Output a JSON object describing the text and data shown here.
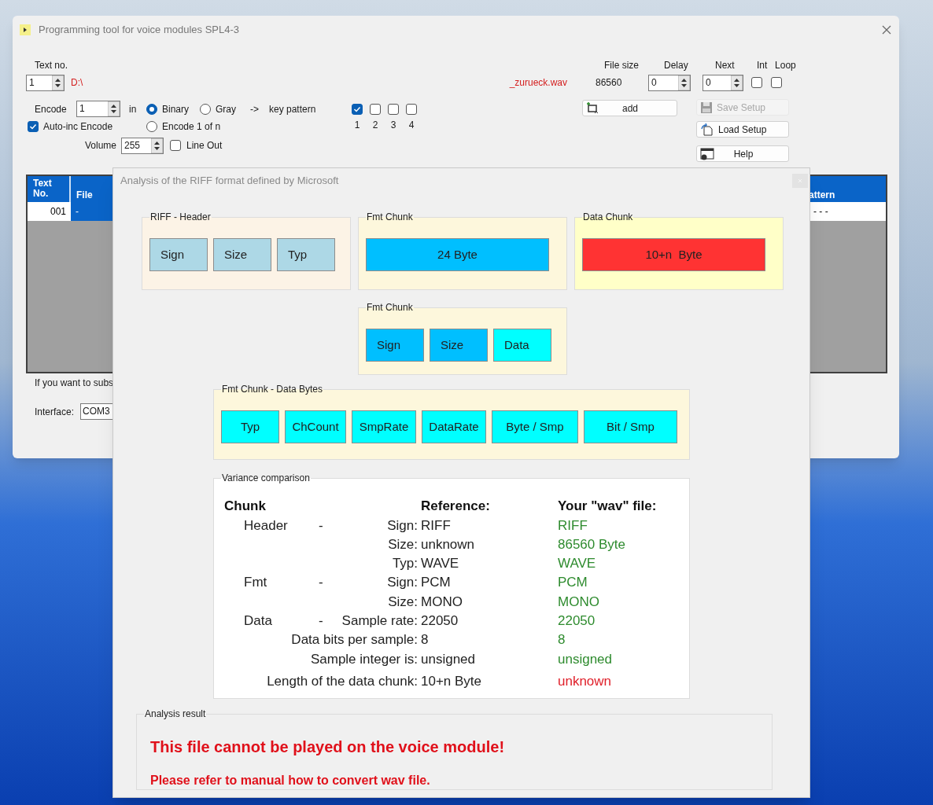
{
  "main_window": {
    "title": "Programming tool for voice modules SPL4-3",
    "text_no": {
      "label": "Text no.",
      "value": "1"
    },
    "path": "D:\\",
    "file_name": "_zurueck.wav",
    "file_size": {
      "label": "File size",
      "value": "86560"
    },
    "delay": {
      "label": "Delay",
      "value": "0"
    },
    "next": {
      "label": "Next",
      "value": "0"
    },
    "int": {
      "label": "Int",
      "checked": false
    },
    "loop": {
      "label": "Loop",
      "checked": false
    },
    "encode": {
      "label": "Encode",
      "value": "1",
      "in_label": "in"
    },
    "encode_modes": [
      {
        "label": "Binary",
        "selected": true
      },
      {
        "label": "Gray",
        "selected": false
      },
      {
        "label": "Encode 1 of n",
        "selected": false
      }
    ],
    "arrow": "->",
    "key_pattern_label": "key pattern",
    "key_pattern": [
      {
        "label": "1",
        "checked": true
      },
      {
        "label": "2",
        "checked": false
      },
      {
        "label": "3",
        "checked": false
      },
      {
        "label": "4",
        "checked": false
      }
    ],
    "auto_inc": {
      "label": "Auto-inc Encode",
      "checked": true
    },
    "volume": {
      "label": "Volume",
      "value": "255"
    },
    "line_out": {
      "label": "Line Out",
      "checked": false
    },
    "buttons": [
      {
        "kind": "add",
        "label": "add",
        "disabled": false
      },
      {
        "kind": "save",
        "label": "Save Setup",
        "disabled": true
      },
      {
        "kind": "load",
        "label": "Load Setup",
        "disabled": false
      },
      {
        "kind": "help",
        "label": "Help",
        "disabled": false
      }
    ],
    "table": {
      "columns": [
        "Text No.",
        "File",
        "attern"
      ],
      "rows": [
        {
          "cells": [
            {
              "text": "001",
              "selected": false
            },
            {
              "text": "-",
              "selected": true
            },
            {
              "text": "- - -",
              "selected": false
            }
          ]
        }
      ]
    },
    "hint": "If you want to subs",
    "interface": {
      "label": "Interface:",
      "value": "COM3"
    }
  },
  "dialog": {
    "title": "Analysis of the RIFF format defined by Microsoft",
    "chunk_groups": [
      {
        "title": "RIFF - Header",
        "color": "#fcf3e6",
        "blocks": [
          {
            "label": "Sign",
            "color": "#add8e6"
          },
          {
            "label": "Size",
            "color": "#add8e6"
          },
          {
            "label": "Typ",
            "color": "#add8e6"
          }
        ]
      },
      {
        "title": "Fmt Chunk",
        "color": "#fdf7dc",
        "blocks": [
          {
            "label": "24 Byte",
            "color": "#00bfff"
          }
        ]
      },
      {
        "title": "Data Chunk",
        "color": "#ffffc8",
        "blocks": [
          {
            "label": "10+n  Byte",
            "color": "#ff3333"
          }
        ]
      }
    ],
    "fmt_chunk": {
      "title": "Fmt Chunk",
      "color": "#fdf7dc",
      "blocks": [
        {
          "label": "Sign",
          "color": "#00bfff"
        },
        {
          "label": "Size",
          "color": "#00bfff"
        },
        {
          "label": "Data",
          "color": "#00ffff"
        }
      ]
    },
    "data_bytes": {
      "title": "Fmt Chunk - Data Bytes",
      "color": "#fdf7dc",
      "blocks": [
        {
          "label": "Typ",
          "color": "#00ffff"
        },
        {
          "label": "ChCount",
          "color": "#00ffff"
        },
        {
          "label": "SmpRate",
          "color": "#00ffff"
        },
        {
          "label": "DataRate",
          "color": "#00ffff"
        },
        {
          "label": "Byte / Smp",
          "color": "#00ffff"
        },
        {
          "label": "Bit / Smp",
          "color": "#00ffff"
        }
      ]
    },
    "variance": {
      "title": "Variance comparison",
      "headers": [
        "Chunk",
        "Reference:",
        "Your \"wav\" file:"
      ],
      "rows": [
        {
          "chunk": "Header",
          "dash": "-",
          "field": "Sign:",
          "reference": "RIFF",
          "yours": "RIFF",
          "match": true
        },
        {
          "field": "Size:",
          "reference": "unknown",
          "yours": "86560 Byte",
          "match": true
        },
        {
          "field": "Typ:",
          "reference": "WAVE",
          "yours": "WAVE",
          "match": true
        },
        {
          "chunk": "Fmt",
          "dash": "-",
          "field": "Sign:",
          "reference": "PCM",
          "yours": "PCM",
          "match": true
        },
        {
          "field": "Size:",
          "reference": "MONO",
          "yours": "MONO",
          "match": true
        },
        {
          "chunk": "Data",
          "dash": "-",
          "field": "Sample rate:",
          "reference": "22050",
          "yours": "22050",
          "match": true
        },
        {
          "field": "Data bits per sample:",
          "reference": "8",
          "yours": "8",
          "match": true
        },
        {
          "field": "Sample integer is:",
          "reference": "unsigned",
          "yours": "unsigned",
          "match": true
        },
        {
          "field": "Length of the data chunk:",
          "reference": "10+n Byte",
          "yours": "unknown",
          "match": false
        }
      ]
    },
    "result": {
      "title": "Analysis result",
      "message": "This file cannot be played on the voice module!",
      "hint": "Please refer to manual how to convert wav file."
    }
  }
}
